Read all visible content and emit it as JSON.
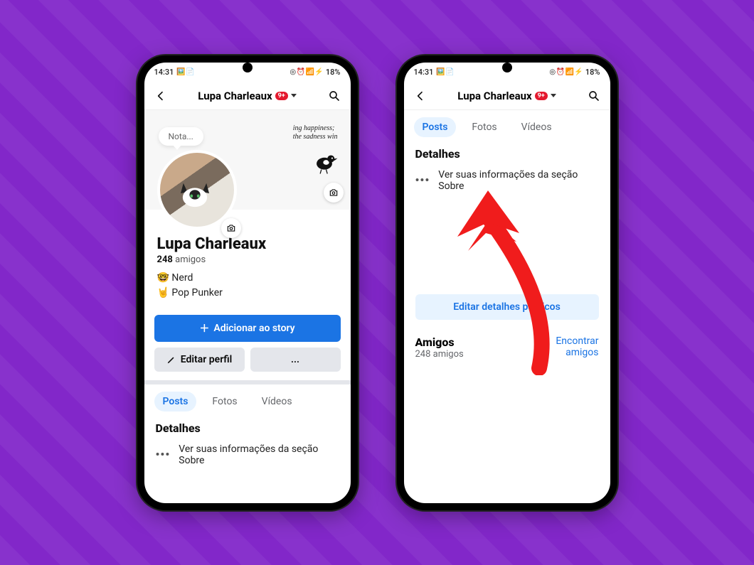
{
  "status": {
    "time": "14:31",
    "left_icons": "🖼️ 📄",
    "right_icons": "◎ ⏰ 📶 ⚡",
    "battery_pct": "18%"
  },
  "header": {
    "title": "Lupa Charleaux",
    "notification_badge": "9+"
  },
  "cover": {
    "nota": "Nota...",
    "quote_line1": "ing happiness;",
    "quote_line2": "the sadness win"
  },
  "profile": {
    "name": "Lupa Charleaux",
    "friend_count": "248",
    "friends_label": "amigos",
    "bio_line1_emoji": "🤓",
    "bio_line1": "Nerd",
    "bio_line2_emoji": "🤘",
    "bio_line2": "Pop Punker",
    "add_story": "Adicionar ao story",
    "edit_profile": "Editar perfil",
    "more": "..."
  },
  "tabs": {
    "posts": "Posts",
    "photos": "Fotos",
    "videos": "Vídeos"
  },
  "details": {
    "heading": "Detalhes",
    "about_row": "Ver suas informações da seção Sobre",
    "edit_public": "Editar detalhes públicos"
  },
  "friends_section": {
    "heading": "Amigos",
    "subtext": "248 amigos",
    "find": "Encontrar amigos"
  }
}
